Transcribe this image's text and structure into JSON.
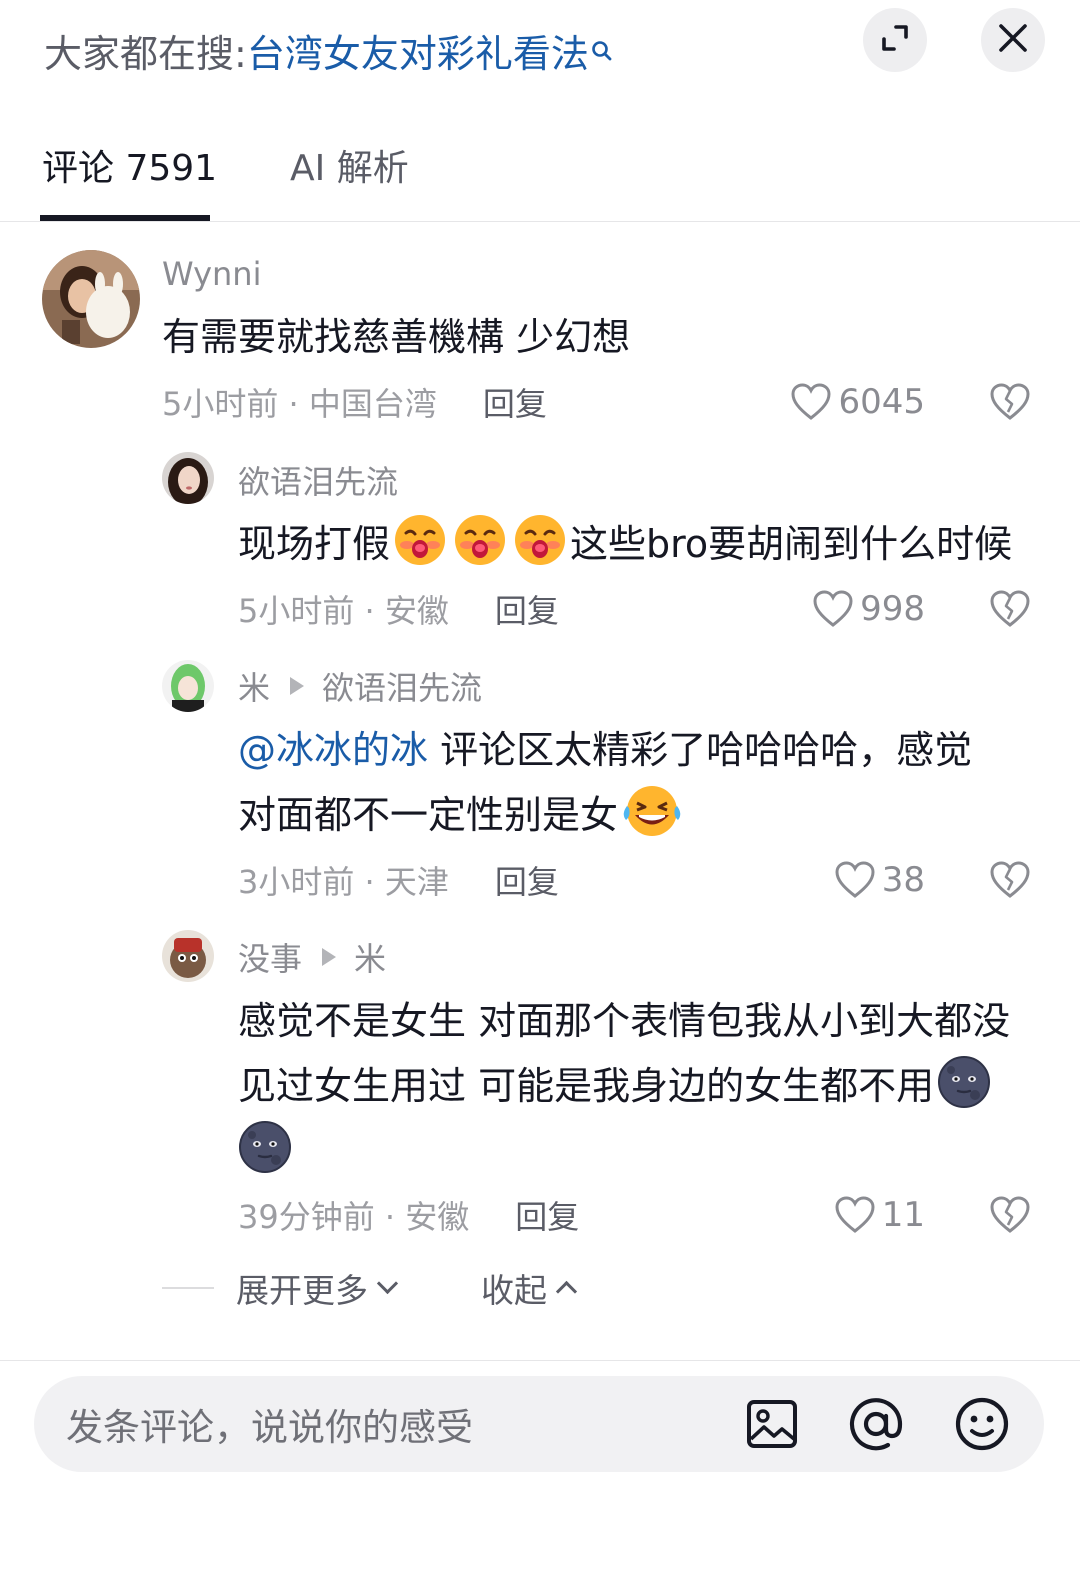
{
  "header": {
    "search_prefix": "大家都在搜:",
    "search_term": "台湾女友对彩礼看法",
    "icons": {
      "search": "search-icon",
      "expand": "expand-icon",
      "close": "close-icon"
    }
  },
  "tabs": [
    {
      "label": "评论 7591",
      "active": true
    },
    {
      "label": "AI 解析",
      "active": false
    }
  ],
  "comments": [
    {
      "user": "Wynni",
      "text": "有需要就找慈善機構 少幻想",
      "time_location": "5小时前 · 中国台湾",
      "reply_label": "回复",
      "likes": "6045"
    },
    {
      "user": "欲语泪先流",
      "text_before": "现场打假",
      "emojis": [
        "kiss-emoji",
        "kiss-emoji",
        "kiss-emoji"
      ],
      "text_after": "这些bro要胡闹到什么时候",
      "time_location": "5小时前 · 安徽",
      "reply_label": "回复",
      "likes": "998"
    },
    {
      "user": "米",
      "reply_to": "欲语泪先流",
      "mention": "@冰冰的冰",
      "text_line1": "评论区太精彩了哈哈哈哈，感觉",
      "text_line2": "对面都不一定性别是女",
      "emoji": "laughing-tears-emoji",
      "time_location": "3小时前 · 天津",
      "reply_label": "回复",
      "likes": "38"
    },
    {
      "user": "没事",
      "reply_to": "米",
      "text_line1": "感觉不是女生 对面那个表情包我从小到大都没",
      "text_line2": "见过女生用过 可能是我身边的女生都不用",
      "emojis": [
        "dark-moon-face-emoji",
        "dark-moon-face-emoji"
      ],
      "time_location": "39分钟前 · 安徽",
      "reply_label": "回复",
      "likes": "11"
    }
  ],
  "expand": {
    "more_label": "展开更多",
    "collapse_label": "收起"
  },
  "input": {
    "placeholder": "发条评论，说说你的感受",
    "icons": [
      "image-icon",
      "at-icon",
      "emoji-icon"
    ]
  },
  "colors": {
    "link": "#1a5ca8",
    "text": "#161823",
    "muted": "#9c9da2",
    "bar_bg": "#f1f1f3"
  }
}
